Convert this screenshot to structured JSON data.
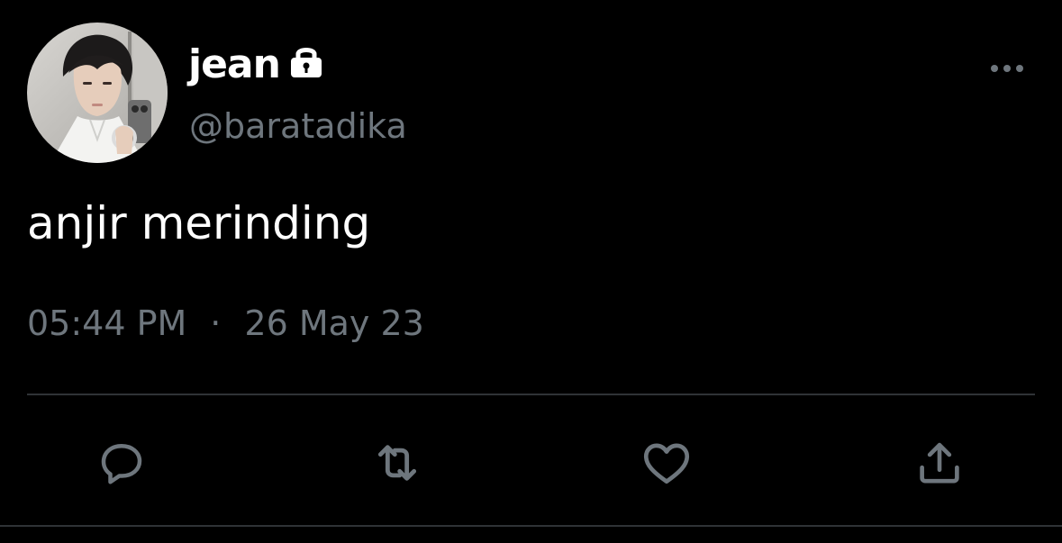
{
  "colors": {
    "background": "#000000",
    "text_primary": "#ffffff",
    "text_secondary": "#6e767d",
    "divider": "#2f3336",
    "icon": "#6e767d"
  },
  "author": {
    "display_name": "jean",
    "handle": "@baratadika",
    "protected_icon": "lock-icon",
    "avatar_icon": "avatar-photo"
  },
  "tweet": {
    "text": "anjir merinding",
    "time": "05:44 PM",
    "separator": "·",
    "date": "26 May 23"
  },
  "menu": {
    "more_icon": "more-horizontal-icon"
  },
  "actions": [
    {
      "name": "reply",
      "icon": "reply-icon"
    },
    {
      "name": "retweet",
      "icon": "retweet-icon"
    },
    {
      "name": "like",
      "icon": "heart-icon"
    },
    {
      "name": "share",
      "icon": "share-icon"
    }
  ]
}
